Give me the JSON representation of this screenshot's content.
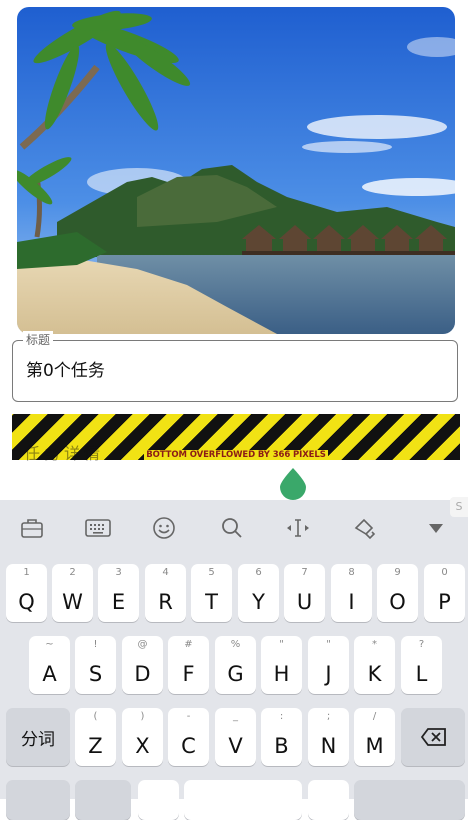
{
  "photo": {
    "alt": "beach-scene"
  },
  "title_field": {
    "label": "标题",
    "value": "第0个任务"
  },
  "overflow_banner": {
    "text": "BOTTOM OVERFLOWED BY 366 PIXELS",
    "ghost_text": "任务详情"
  },
  "keyboard": {
    "toolbar": [
      "briefcase-icon",
      "keyboard-icon",
      "emoji-icon",
      "search-icon",
      "cursor-icon",
      "brush-icon",
      "collapse-icon"
    ],
    "row1": [
      {
        "hint": "1",
        "label": "Q"
      },
      {
        "hint": "2",
        "label": "W"
      },
      {
        "hint": "3",
        "label": "E"
      },
      {
        "hint": "4",
        "label": "R"
      },
      {
        "hint": "5",
        "label": "T"
      },
      {
        "hint": "6",
        "label": "Y"
      },
      {
        "hint": "7",
        "label": "U"
      },
      {
        "hint": "8",
        "label": "I"
      },
      {
        "hint": "9",
        "label": "O"
      },
      {
        "hint": "0",
        "label": "P"
      }
    ],
    "row2": [
      {
        "hint": "~",
        "label": "A"
      },
      {
        "hint": "!",
        "label": "S"
      },
      {
        "hint": "@",
        "label": "D"
      },
      {
        "hint": "#",
        "label": "F"
      },
      {
        "hint": "%",
        "label": "G"
      },
      {
        "hint": "\"",
        "label": "H"
      },
      {
        "hint": "\"",
        "label": "J"
      },
      {
        "hint": "*",
        "label": "K"
      },
      {
        "hint": "?",
        "label": "L"
      }
    ],
    "row3": [
      {
        "hint": "(",
        "label": "Z"
      },
      {
        "hint": ")",
        "label": "X"
      },
      {
        "hint": "-",
        "label": "C"
      },
      {
        "hint": "_",
        "label": "V"
      },
      {
        "hint": ":",
        "label": "B"
      },
      {
        "hint": ";",
        "label": "N"
      },
      {
        "hint": "/",
        "label": "M"
      }
    ],
    "segment_key": "分词",
    "corner_badge": "S"
  }
}
